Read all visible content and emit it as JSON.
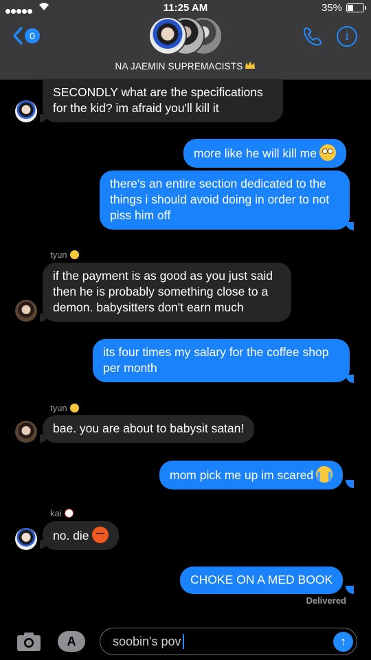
{
  "status_bar": {
    "time": "11:25 AM",
    "battery_percent": "35%",
    "battery_level": 0.35
  },
  "header": {
    "back_badge": "0",
    "group_name": "NA JAEMIN SUPREMACISTS"
  },
  "messages": [
    {
      "direction": "in",
      "sender": "",
      "text": "SECONDLY what are the specifications for the kid? im afraid you'll kill it"
    },
    {
      "direction": "out",
      "text": "more like he will kill me",
      "emoji": "flushed-face"
    },
    {
      "direction": "out",
      "text": "there's an entire section dedicated to the things i should avoid doing in order to not piss him off"
    },
    {
      "direction": "in",
      "sender": "tyun",
      "text": "if the payment is as good as you just said then he is probably something close to a demon. babysitters don't earn much"
    },
    {
      "direction": "out",
      "text": "its four times my salary for the coffee shop per month"
    },
    {
      "direction": "in",
      "sender": "tyun",
      "text": "bae. you are about to babysit satan!"
    },
    {
      "direction": "out",
      "text": "mom pick me up im scared",
      "emoji": "loudly-crying-face"
    },
    {
      "direction": "in",
      "sender": "kai",
      "text": "no. die",
      "emoji": "angry-face"
    },
    {
      "direction": "out",
      "text": "CHOKE ON A MED BOOK"
    }
  ],
  "delivery_status": "Delivered",
  "composer": {
    "text": "soobin's pov"
  },
  "colors": {
    "outgoing": "#1a82fb",
    "incoming": "#262628",
    "accent": "#1f8bff",
    "header": "#3a3a3c"
  }
}
